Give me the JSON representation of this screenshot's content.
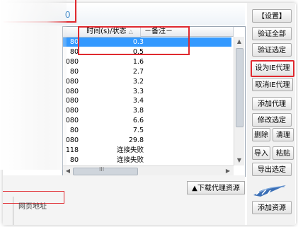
{
  "status": {
    "count": "0"
  },
  "table": {
    "headers": {
      "time": "时间(s)/状态",
      "remark": "－备注－"
    },
    "rows": [
      {
        "port": "80",
        "time": "0.3",
        "selected": true
      },
      {
        "port": "80",
        "time": "0.5"
      },
      {
        "port": "080",
        "time": "1.6"
      },
      {
        "port": "80",
        "time": "2.7"
      },
      {
        "port": "080",
        "time": "3.2"
      },
      {
        "port": "080",
        "time": "3.3"
      },
      {
        "port": "080",
        "time": "3.4"
      },
      {
        "port": "080",
        "time": "3.8"
      },
      {
        "port": "080",
        "time": "6.6"
      },
      {
        "port": "80",
        "time": "7.5"
      },
      {
        "port": "080",
        "time": "29.8"
      },
      {
        "port": "118",
        "time": "连接失败"
      },
      {
        "port": "80",
        "time": "连接失败"
      }
    ],
    "hscroll_glyph": "III"
  },
  "buttons": {
    "settings": "【设置】",
    "verify_all": "验证全部",
    "verify_selected": "验证选定",
    "set_ie_proxy": "设为IE代理",
    "cancel_ie_proxy": "取消IE代理",
    "add_proxy": "添加代理",
    "modify_selected": "修改选定",
    "delete": "删除",
    "clear": "清理",
    "import": "导入",
    "paste": "粘贴",
    "export_selected": "导出选定",
    "add_resource": "添加资源",
    "download_resource": "▲下载代理资源"
  },
  "bottom": {
    "label": "网页地址"
  },
  "colors": {
    "accent": "#2f7fc4",
    "highlight": "#e0292f",
    "selection": "#3399ff"
  },
  "logo_icon": "hijt-logo-icon"
}
